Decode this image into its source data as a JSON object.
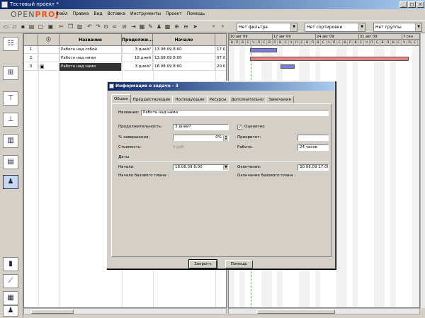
{
  "window": {
    "title": "Тестовый проект *",
    "min": "_",
    "max": "□",
    "close": "×"
  },
  "logo": {
    "text_a": "OPEN",
    "text_b": "PROJ"
  },
  "menu": [
    "Файл",
    "Правка",
    "Вид",
    "Вставка",
    "Инструменты",
    "Проект",
    "Помощь"
  ],
  "toolbar": {
    "filter": "Нет фильтра",
    "sort": "Нет сортировки",
    "group": "Нет группы",
    "nav_left": "«",
    "nav_right": "»"
  },
  "grid": {
    "headers": {
      "info": "ⓘ",
      "name": "Название",
      "duration": "Продолжи...",
      "start": "Начало",
      "finish": ""
    },
    "rows": [
      {
        "id": "1",
        "name": "Работа над собой",
        "duration": "3 дней?",
        "start": "13.08.09 8:00",
        "finish": "17.0"
      },
      {
        "id": "2",
        "name": "Работа над ними",
        "duration": "18 дней",
        "start": "13.08.09 8:00",
        "finish": "07.0"
      },
      {
        "id": "3",
        "name": "Работа над нами",
        "duration": "3 дней?",
        "start": "18.08.09 8:00",
        "finish": "20.0"
      }
    ]
  },
  "gantt": {
    "weeks": [
      "10 авг 09",
      "17 авг 09",
      "24 авг 09",
      "31 авг 09",
      "7 сен"
    ],
    "days": [
      "В",
      "П",
      "В",
      "С",
      "Ч",
      "П",
      "С",
      "В",
      "П",
      "В",
      "С",
      "Ч",
      "П",
      "С",
      "В",
      "П",
      "В",
      "С",
      "Ч",
      "П",
      "С",
      "В",
      "П",
      "В",
      "С",
      "Ч",
      "П",
      "С",
      "В",
      "П",
      "В",
      "С",
      "Ч",
      "П",
      "С",
      "В"
    ],
    "colors": {
      "task": "#7b7bdf",
      "critical": "#f08080"
    }
  },
  "dialog": {
    "title": "Информация о задаче - 3",
    "tabs": [
      "Общее",
      "Предшествующие",
      "Последующие",
      "Ресурсы",
      "Дополнительно",
      "Замечания"
    ],
    "name_label": "Название:",
    "name_value": "Работа над нами",
    "duration_label": "Продолжительность:",
    "duration_value": "3 дней?",
    "estimated_label": "Оценочно",
    "estimated_checked": true,
    "percent_label": "% завершения:",
    "percent_value": "0%",
    "priority_label": "Приоритет:",
    "priority_value": "",
    "cost_label": "Стоимость:",
    "cost_value": "0 руб",
    "work_label": "Работа:",
    "work_value": "24 часов",
    "dates_label": "Даты",
    "start_label": "Начало:",
    "start_value": "18.08.09 8:00",
    "finish_label": "Окончание:",
    "finish_value": "20.08.09 17:00",
    "baseline_start_label": "Начало базового плана :",
    "baseline_finish_label": "Окончание базового плана :",
    "close_button": "Закрыть",
    "help_button": "Помощь"
  }
}
